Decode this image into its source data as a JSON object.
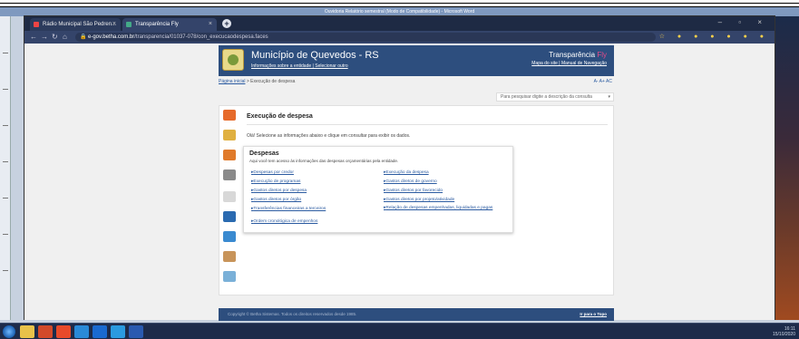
{
  "desktop": {
    "word_title": "Ouvidoria Relatório semestral (Modo de Compatibilidade) - Microsoft Word"
  },
  "browser": {
    "tabs": [
      {
        "label": "Rádio Municipal São Pedren..."
      },
      {
        "label": "Transparência Fly"
      }
    ],
    "new_tab": "+",
    "url_host": "e-gov.betha.com.br",
    "url_path": "/transparencia/01037-078/con_execucaodespesa.faces"
  },
  "header": {
    "municipality": "Município de Quevedos - RS",
    "entity_links": "Informações sobre a entidade | Selecionar outro",
    "brand_prefix": "Transparência ",
    "brand_suffix": "Fly",
    "brand_links": "Mapa do site | Manual de Navegação"
  },
  "breadcrumb": {
    "home": "Página inicial",
    "separator": " > ",
    "current": "Execução de despesa",
    "font_controls": "A-  A+  AC"
  },
  "search": {
    "placeholder": "Para pesquisar digite a descrição da consulta"
  },
  "content": {
    "title": "Execução de despesa",
    "intro": "Olá! Selecione as informações abaixo e clique em consultar para exibir os dados."
  },
  "card": {
    "title": "Despesas",
    "description": "Aqui você tem acesso às informações das despesas orçamentárias pela entidade.",
    "left_links": [
      "Despesas por credor",
      "Execução de programas",
      "Gastos diretos por despesa",
      "Gastos diretos por órgão",
      "Transferências financeiras a terceiros",
      "Ordem cronológica de empenhos"
    ],
    "right_links": [
      "Execução da despesa",
      "Gastos diretos de governo",
      "Gastos diretos por favorecido",
      "Gastos diretos por projeto/atividade",
      "Relação de despesas empenhadas, liquidadas e pagas"
    ]
  },
  "footer": {
    "copyright": "Copyright © Betha Sistemas. Todos os direitos reservados desde 1985.",
    "back_to_top": "Ir para o Topo"
  },
  "taskbar": {
    "tray_time": "16:11",
    "tray_date": "15/10/2020"
  }
}
